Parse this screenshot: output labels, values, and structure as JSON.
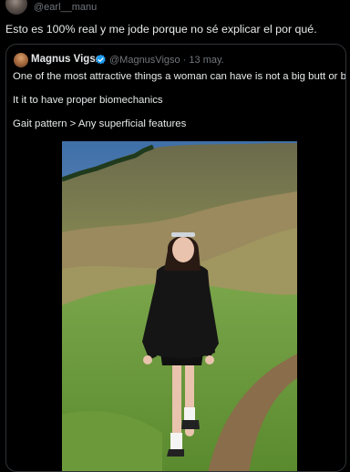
{
  "header": {
    "handle": "@earl__manu"
  },
  "tweet": {
    "text": "Esto es 100% real y me jode porque no sé explicar el por qué."
  },
  "quote": {
    "author_name": "Magnus Vigsø",
    "author_handle": "@MagnusVigso",
    "date": "13 may.",
    "separator": "·",
    "lines": [
      "One of the most attractive things a woman can have is not a big butt or breasts",
      "It it to have proper biomechanics",
      "Gait pattern > Any superficial features"
    ]
  },
  "icons": {
    "verified": "verified-badge-icon",
    "verified_color": "#1d9bf0"
  },
  "colors": {
    "background": "#000000",
    "text": "#e7e9ea",
    "secondary_text": "#71767b",
    "border": "#2f3336"
  }
}
